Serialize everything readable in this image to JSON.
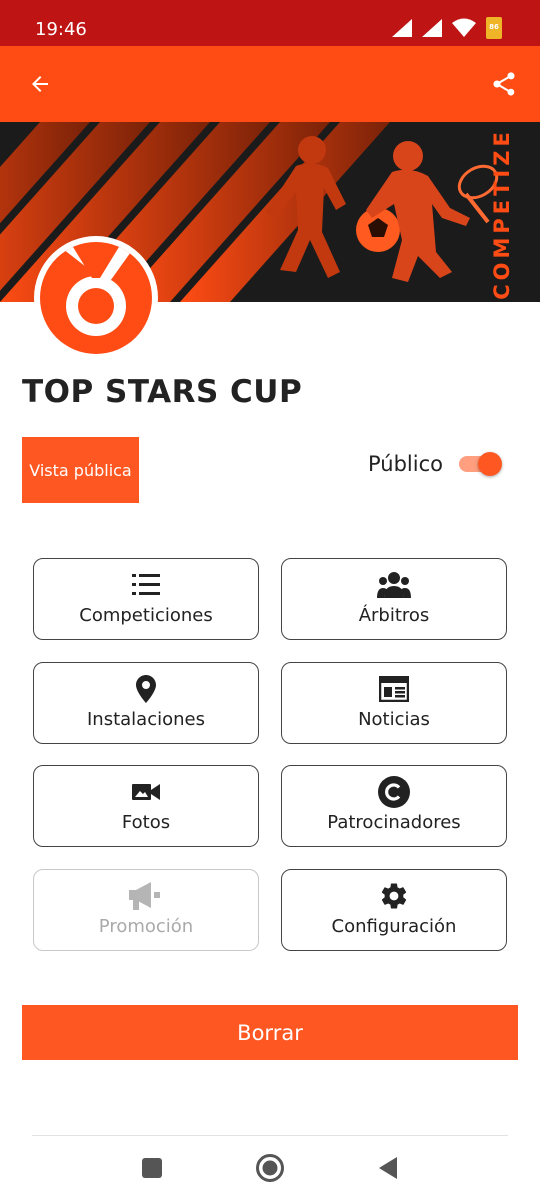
{
  "status_bar": {
    "time": "19:46",
    "battery": "86"
  },
  "banner": {
    "brand_text": "COMPETIZE"
  },
  "page": {
    "title": "TOP STARS CUP"
  },
  "actions": {
    "public_view_label": "Vista pública",
    "public_label": "Público",
    "public_enabled": true
  },
  "menu": [
    {
      "label": "Competiciones",
      "icon": "list-numbered-icon",
      "enabled": true
    },
    {
      "label": "Árbitros",
      "icon": "group-icon",
      "enabled": true
    },
    {
      "label": "Instalaciones",
      "icon": "location-pin-icon",
      "enabled": true
    },
    {
      "label": "Noticias",
      "icon": "newspaper-icon",
      "enabled": true
    },
    {
      "label": "Fotos",
      "icon": "video-camera-icon",
      "enabled": true
    },
    {
      "label": "Patrocinadores",
      "icon": "copyright-icon",
      "enabled": true
    },
    {
      "label": "Promoción",
      "icon": "megaphone-icon",
      "enabled": false
    },
    {
      "label": "Configuración",
      "icon": "gear-icon",
      "enabled": true
    }
  ],
  "footer": {
    "delete_label": "Borrar"
  },
  "colors": {
    "primary": "#ff5722",
    "app_bar": "#ff4c14",
    "status_bar": "#bf1414",
    "banner_bg": "#1b1b1b"
  }
}
